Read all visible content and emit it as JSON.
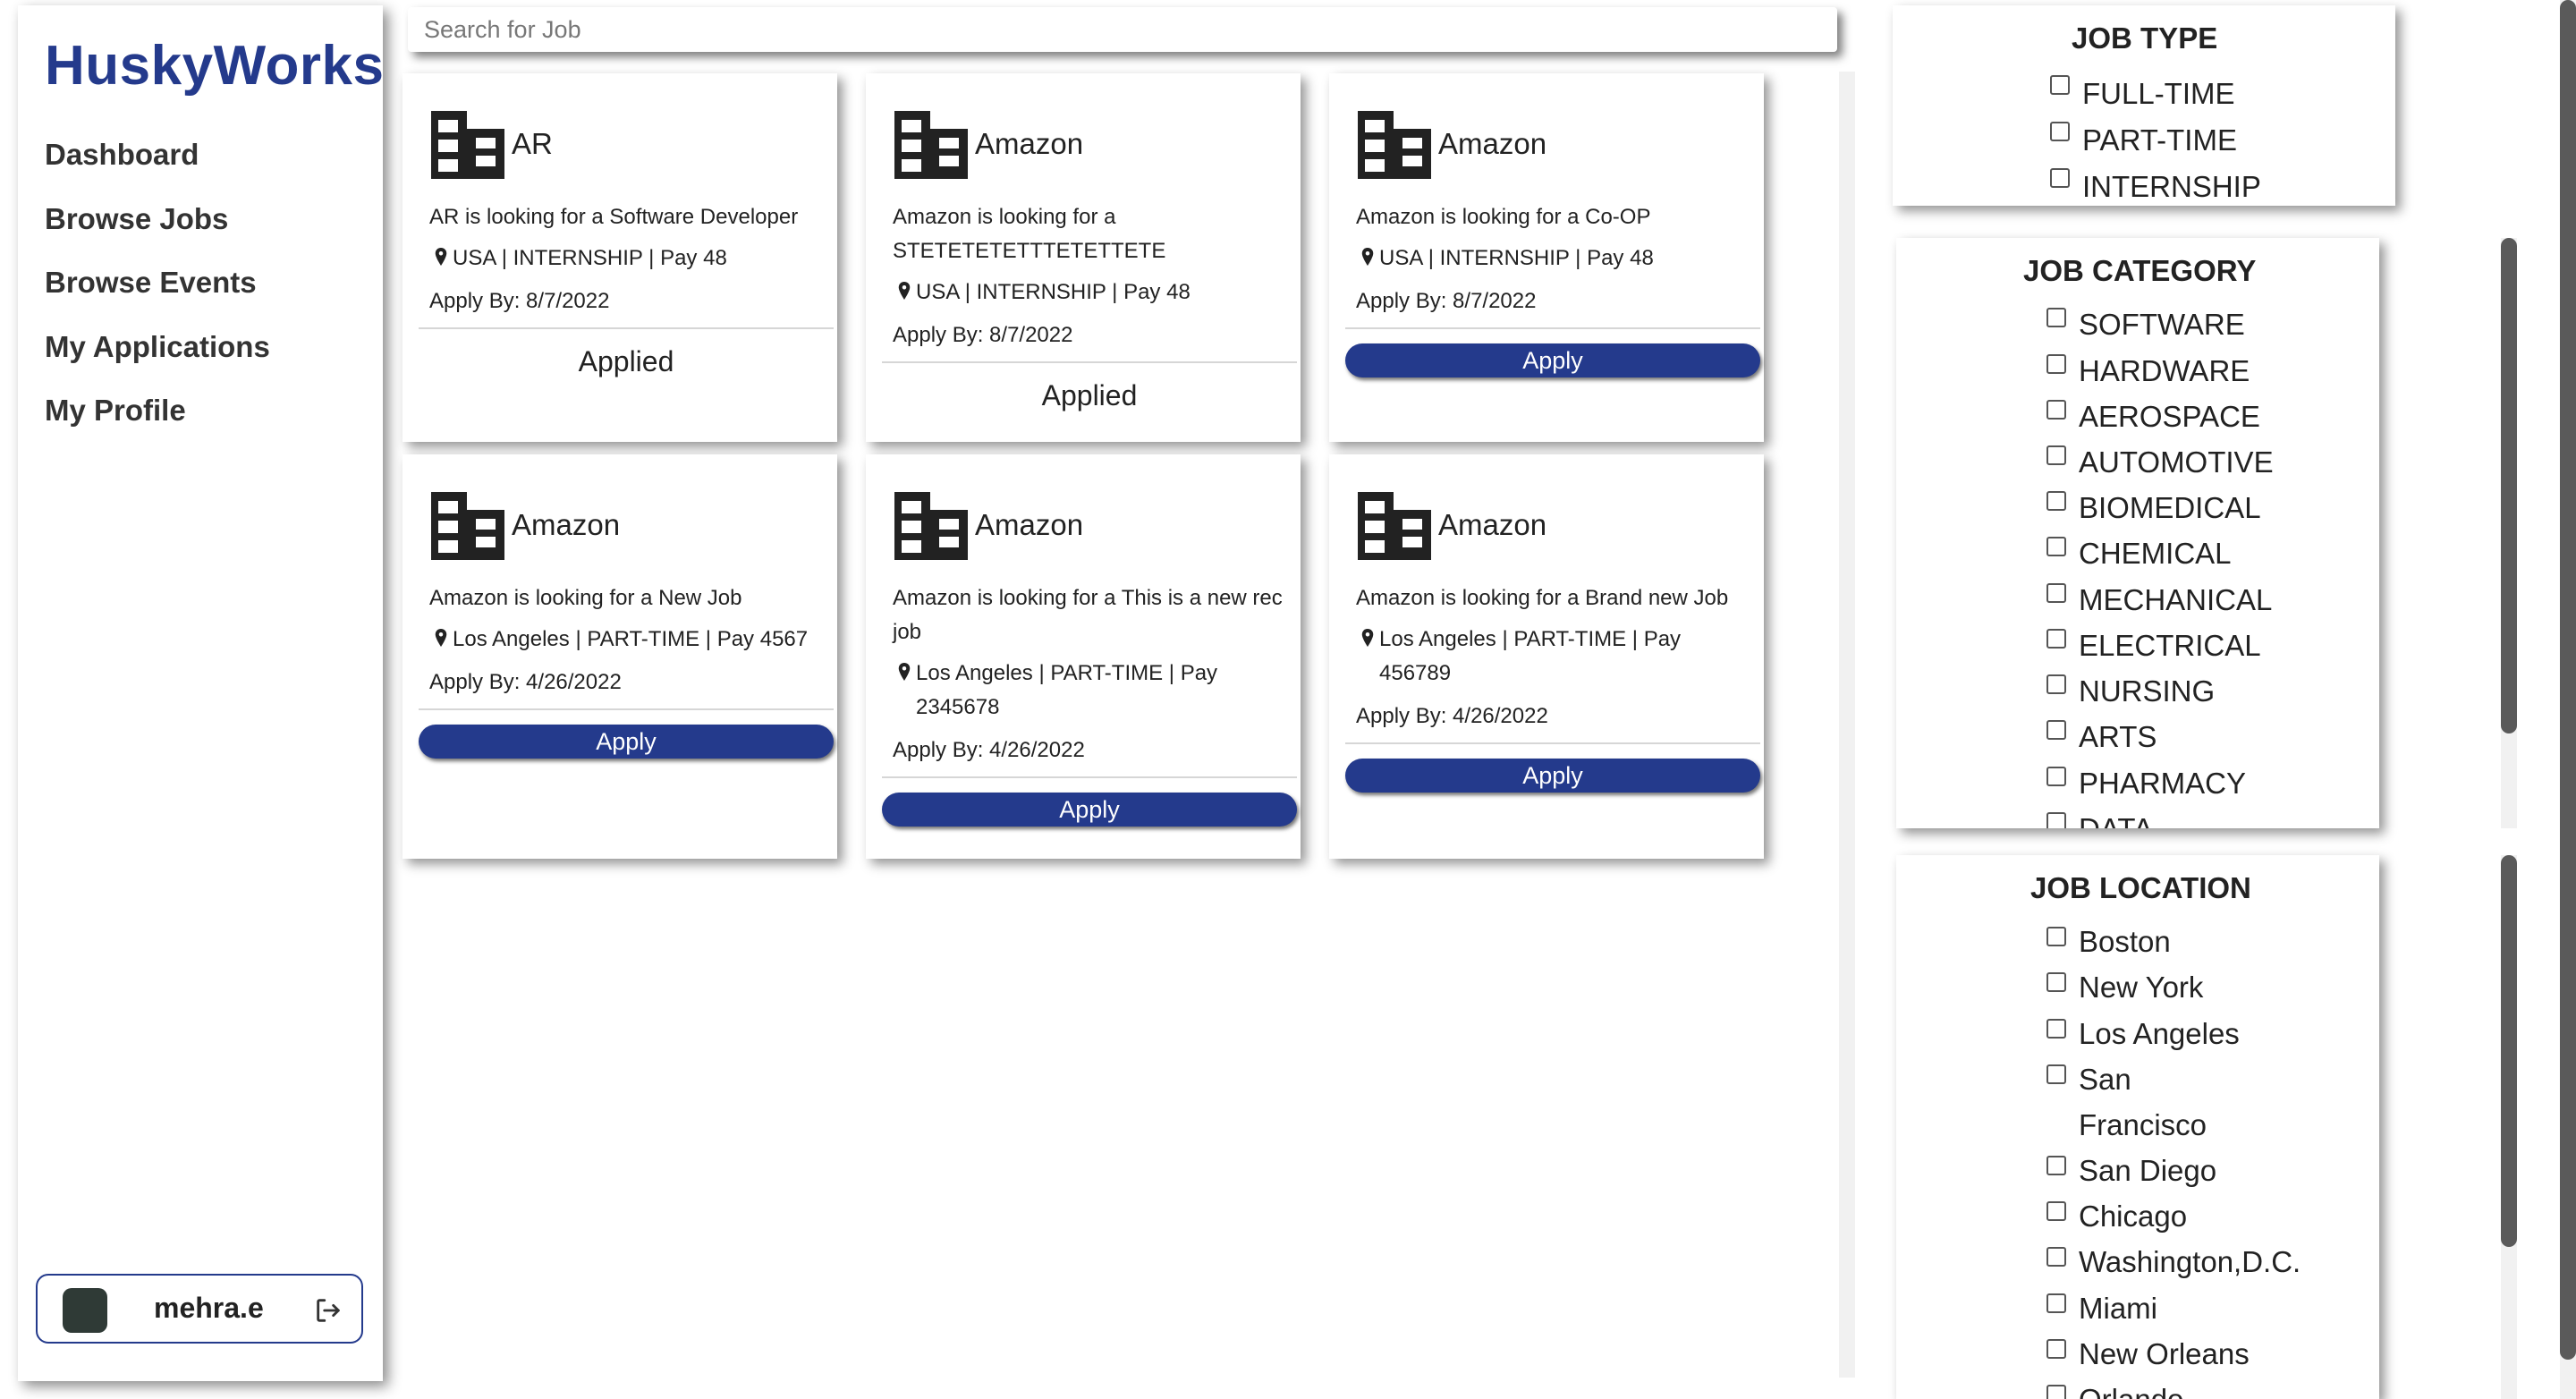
{
  "brand": "HuskyWorks",
  "nav": [
    "Dashboard",
    "Browse Jobs",
    "Browse Events",
    "My Applications",
    "My Profile"
  ],
  "user": {
    "name": "mehra.e"
  },
  "search": {
    "placeholder": "Search for Job"
  },
  "jobs": [
    {
      "company": "AR",
      "desc": "AR is looking for a Software Developer",
      "location": "USA | INTERNSHIP | Pay 48",
      "apply_by": "Apply By: 8/7/2022",
      "action": "Applied"
    },
    {
      "company": "Amazon",
      "desc": "Amazon is looking for a STETETETETTTETETTETE",
      "location": "USA | INTERNSHIP | Pay 48",
      "apply_by": "Apply By: 8/7/2022",
      "action": "Applied"
    },
    {
      "company": "Amazon",
      "desc": "Amazon is looking for a Co-OP",
      "location": "USA | INTERNSHIP | Pay 48",
      "apply_by": "Apply By: 8/7/2022",
      "action": "Apply"
    },
    {
      "company": "Amazon",
      "desc": "Amazon is looking for a New Job",
      "location": "Los Angeles | PART-TIME | Pay 4567",
      "apply_by": "Apply By: 4/26/2022",
      "action": "Apply"
    },
    {
      "company": "Amazon",
      "desc": "Amazon is looking for a This is a new rec job",
      "location": "Los Angeles | PART-TIME | Pay 2345678",
      "apply_by": "Apply By: 4/26/2022",
      "action": "Apply"
    },
    {
      "company": "Amazon",
      "desc": "Amazon is looking for a Brand new Job",
      "location": "Los Angeles | PART-TIME | Pay 456789",
      "apply_by": "Apply By: 4/26/2022",
      "action": "Apply"
    }
  ],
  "filters": {
    "job_type": {
      "title": "JOB TYPE",
      "options": [
        "FULL-TIME",
        "PART-TIME",
        "INTERNSHIP"
      ]
    },
    "job_category": {
      "title": "JOB CATEGORY",
      "options": [
        "SOFTWARE",
        "HARDWARE",
        "AEROSPACE",
        "AUTOMOTIVE",
        "BIOMEDICAL",
        "CHEMICAL",
        "MECHANICAL",
        "ELECTRICAL",
        "NURSING",
        "ARTS",
        "PHARMACY",
        "DATA"
      ]
    },
    "job_location": {
      "title": "JOB LOCATION",
      "options": [
        "Boston",
        "New York",
        "Los Angeles",
        "San",
        "Francisco",
        "San Diego",
        "Chicago",
        "Washington,D.C.",
        "Miami",
        "New Orleans",
        "Orlando"
      ]
    }
  },
  "colors": {
    "accent": "#243a8c",
    "button_text": "#ffffff"
  }
}
